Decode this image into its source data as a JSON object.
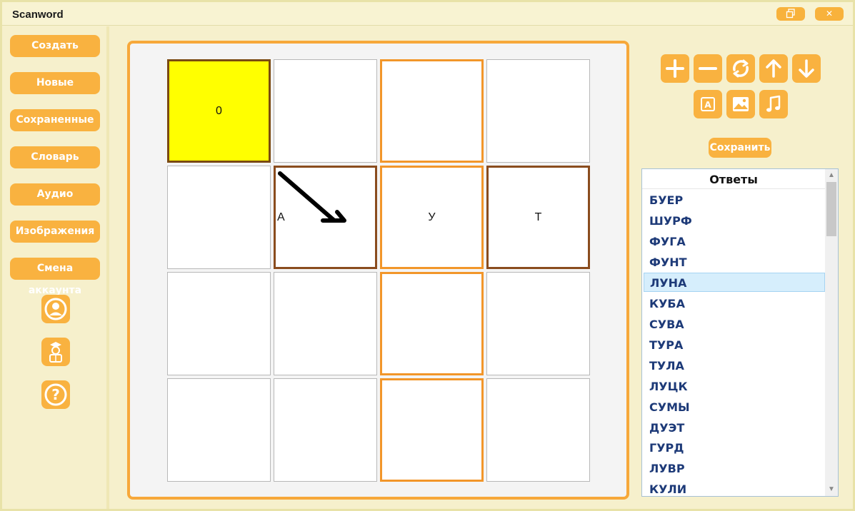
{
  "window": {
    "title": "Scanword",
    "restore_icon": "restore-icon",
    "close_label": "✕"
  },
  "sidebar": {
    "items": [
      {
        "label": "Создать"
      },
      {
        "label": "Новые"
      },
      {
        "label": "Сохраненные"
      },
      {
        "label": "Словарь"
      },
      {
        "label": "Аудио"
      },
      {
        "label": "Изображения"
      },
      {
        "label": "Смена аккаунта"
      }
    ],
    "icons": [
      "user-icon",
      "teacher-icon",
      "help-icon"
    ]
  },
  "grid": {
    "cells": [
      [
        "0",
        "",
        "",
        ""
      ],
      [
        "",
        "А",
        "У",
        "Т"
      ],
      [
        "",
        "",
        "",
        ""
      ],
      [
        "",
        "",
        "",
        ""
      ]
    ]
  },
  "toolbar": {
    "row1": [
      "plus-icon",
      "minus-icon",
      "refresh-icon",
      "arrow-up-icon",
      "arrow-down-icon"
    ],
    "row2": [
      "text-icon",
      "image-icon",
      "music-icon"
    ],
    "save_label": "Сохранить"
  },
  "answers": {
    "header": "Ответы",
    "items": [
      "БУЕР",
      "ШУРФ",
      "ФУГА",
      "ФУНТ",
      "ЛУНА",
      "КУБА",
      "СУВА",
      "ТУРА",
      "ТУЛА",
      "ЛУЦК",
      "СУМЫ",
      "ДУЭТ",
      "ГУРД",
      "ЛУВР",
      "КУЛИ"
    ],
    "selected": "ЛУНА"
  },
  "colors": {
    "accent": "#f9b240",
    "yellow_cell": "#ffff00",
    "brown_border": "#8a4c1e",
    "orange_border": "#f2962a",
    "answer_text": "#1d3a78"
  }
}
